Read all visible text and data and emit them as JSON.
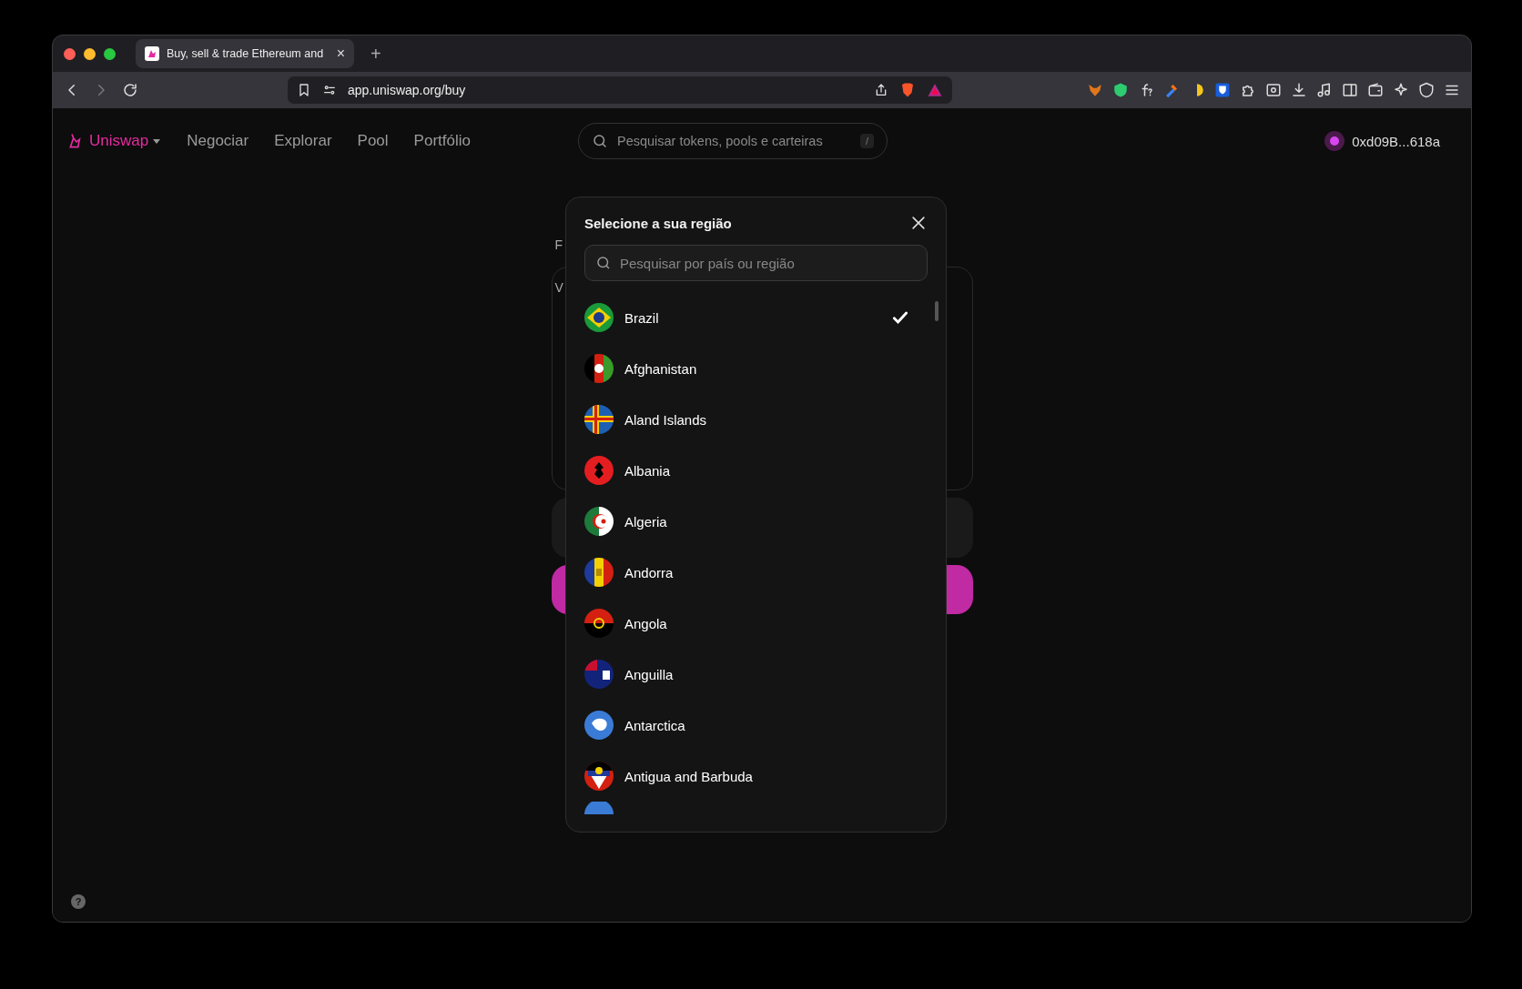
{
  "browser": {
    "tab": {
      "title": "Buy, sell & trade Ethereum and",
      "close": "×"
    },
    "new_tab": "+",
    "url": "app.uniswap.org/buy"
  },
  "nav": {
    "logo": "Uniswap",
    "links": [
      {
        "label": "Negociar"
      },
      {
        "label": "Explorar"
      },
      {
        "label": "Pool"
      },
      {
        "label": "Portfólio"
      }
    ],
    "search": {
      "placeholder": "Pesquisar tokens, pools e carteiras",
      "shortcut": "/"
    },
    "account": "0xd09B...618a"
  },
  "background": {
    "label": "F",
    "card_text": "V"
  },
  "modal": {
    "title": "Selecione a sua região",
    "search": {
      "placeholder": "Pesquisar por país ou região"
    },
    "countries": [
      {
        "name": "Brazil",
        "selected": true
      },
      {
        "name": "Afghanistan",
        "selected": false
      },
      {
        "name": "Aland Islands",
        "selected": false
      },
      {
        "name": "Albania",
        "selected": false
      },
      {
        "name": "Algeria",
        "selected": false
      },
      {
        "name": "Andorra",
        "selected": false
      },
      {
        "name": "Angola",
        "selected": false
      },
      {
        "name": "Anguilla",
        "selected": false
      },
      {
        "name": "Antarctica",
        "selected": false
      },
      {
        "name": "Antigua and Barbuda",
        "selected": false
      }
    ]
  },
  "help": "?"
}
